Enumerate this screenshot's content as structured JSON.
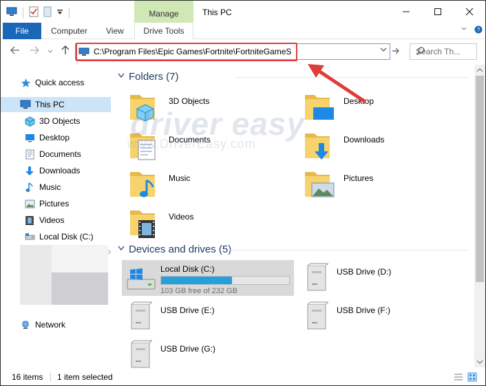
{
  "window": {
    "title": "This PC",
    "controls": [
      "minimize",
      "maximize",
      "close"
    ]
  },
  "ribbon": {
    "context_tab_group": "Manage",
    "tabs": [
      {
        "label": "File",
        "active": true
      },
      {
        "label": "Computer"
      },
      {
        "label": "View"
      },
      {
        "label": "Drive Tools"
      }
    ],
    "help_icon": "question-icon",
    "expand_icon": "chevron-down-icon"
  },
  "address": {
    "path": "C:\\Program Files\\Epic Games\\Fortnite\\FortniteGameS",
    "search_placeholder": "Search Th..."
  },
  "navigation": {
    "items": [
      {
        "label": "Quick access",
        "icon": "star-icon"
      },
      {
        "label": "This PC",
        "icon": "computer-icon",
        "selected": true
      },
      {
        "label": "3D Objects",
        "icon": "cube-icon"
      },
      {
        "label": "Desktop",
        "icon": "desktop-icon"
      },
      {
        "label": "Documents",
        "icon": "documents-icon"
      },
      {
        "label": "Downloads",
        "icon": "download-arrow-icon"
      },
      {
        "label": "Music",
        "icon": "music-note-icon"
      },
      {
        "label": "Pictures",
        "icon": "pictures-icon"
      },
      {
        "label": "Videos",
        "icon": "film-icon"
      },
      {
        "label": "Local Disk (C:)",
        "icon": "drive-icon"
      },
      {
        "label": "Network",
        "icon": "network-icon"
      }
    ]
  },
  "folders": {
    "heading": "Folders (7)",
    "items": [
      {
        "label": "3D Objects"
      },
      {
        "label": "Desktop"
      },
      {
        "label": "Documents"
      },
      {
        "label": "Downloads"
      },
      {
        "label": "Music"
      },
      {
        "label": "Pictures"
      },
      {
        "label": "Videos"
      }
    ]
  },
  "drives": {
    "heading": "Devices and drives (5)",
    "items": [
      {
        "label": "Local Disk (C:)",
        "free_text": "103 GB free of 232 GB",
        "used_fraction": 0.556,
        "selected": true
      },
      {
        "label": "USB Drive (D:)"
      },
      {
        "label": "USB Drive (E:)"
      },
      {
        "label": "USB Drive (F:)"
      },
      {
        "label": "USB Drive (G:)"
      }
    ]
  },
  "status": {
    "item_count": "16 items",
    "selection": "1 item selected"
  },
  "watermark": {
    "brand": "driver easy",
    "url": "www.DriverEasy.com"
  },
  "colors": {
    "accent": "#1a66b8",
    "manage_tab": "#cfe8b6",
    "highlight_box": "#e03c3c",
    "drive_fill": "#26a0da"
  }
}
